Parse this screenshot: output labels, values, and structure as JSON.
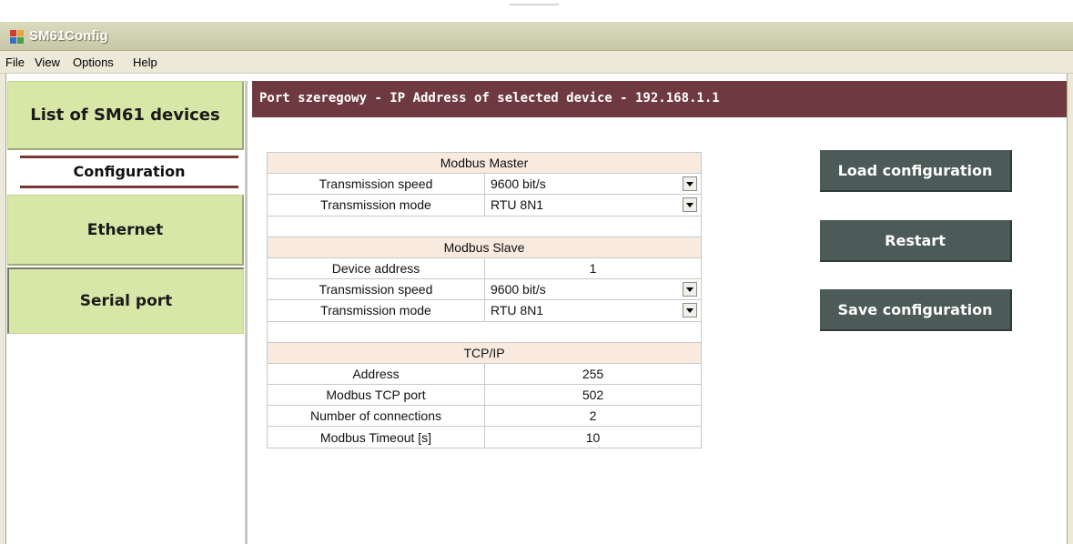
{
  "window": {
    "title": "SM61Config",
    "icon": "app-grid-icon"
  },
  "menu": {
    "items": [
      "File",
      "View",
      "Options",
      "Help"
    ]
  },
  "sidebar": {
    "list_devices": "List of SM61 devices",
    "configuration": "Configuration",
    "ethernet": "Ethernet",
    "serial_port": "Serial port"
  },
  "header": {
    "text": "Port szeregowy - IP Address of selected device - 192.168.1.1"
  },
  "modbus_master": {
    "title": "Modbus Master",
    "speed_label": "Transmission speed",
    "speed_value": "9600 bit/s",
    "mode_label": "Transmission mode",
    "mode_value": "RTU 8N1"
  },
  "modbus_slave": {
    "title": "Modbus Slave",
    "address_label": "Device address",
    "address_value": "1",
    "speed_label": "Transmission speed",
    "speed_value": "9600 bit/s",
    "mode_label": "Transmission mode",
    "mode_value": "RTU 8N1"
  },
  "tcpip": {
    "title": "TCP/IP",
    "address_label": "Address",
    "address_value": "255",
    "port_label": "Modbus TCP port",
    "port_value": "502",
    "connections_label": "Number of connections",
    "connections_value": "2",
    "timeout_label": "Modbus Timeout [s]",
    "timeout_value": "10"
  },
  "actions": {
    "load": "Load configuration",
    "restart": "Restart",
    "save": "Save configuration"
  },
  "colors": {
    "nav_button": "#d7e7a7",
    "header_bar": "#6e3a3f",
    "action_button": "#4c5a58",
    "section_header": "#f8eadf"
  }
}
